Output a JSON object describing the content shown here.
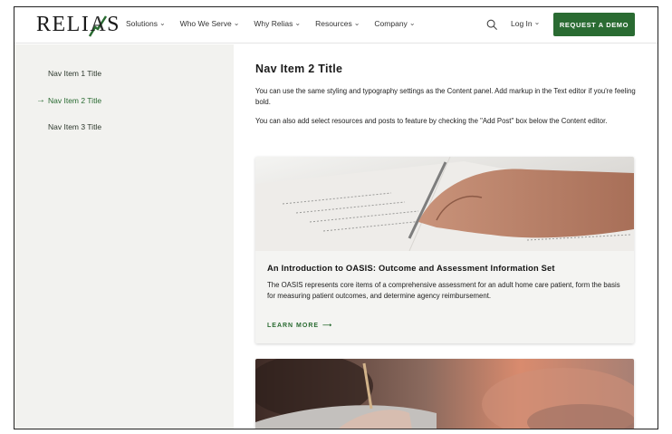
{
  "brand": {
    "logo_text_left": "REL",
    "logo_text_mid": "I",
    "logo_text_a": "A",
    "logo_text_right": "S",
    "accent_color": "#2a6b32"
  },
  "header": {
    "menu": [
      {
        "label": "Solutions"
      },
      {
        "label": "Who We Serve"
      },
      {
        "label": "Why Relias"
      },
      {
        "label": "Resources"
      },
      {
        "label": "Company"
      }
    ],
    "login_label": "Log In",
    "cta_label": "REQUEST A DEMO",
    "icons": {
      "search": "search-icon",
      "chevron": "chevron-down-icon"
    }
  },
  "sidebar": {
    "items": [
      {
        "label": "Nav Item 1 Title",
        "active": false
      },
      {
        "label": "Nav Item 2 Title",
        "active": true
      },
      {
        "label": "Nav Item 3 Title",
        "active": false
      }
    ],
    "active_marker": "→"
  },
  "main": {
    "title": "Nav Item 2 Title",
    "paragraph_1": "You can use the same styling and typography settings as the Content panel. Add markup in the Text editor if you're feeling bold.",
    "paragraph_2": "You can also add select resources and posts to feature by checking the \"Add Post\" box below the Content editor.",
    "cards": [
      {
        "title": "An Introduction to OASIS: Outcome and Assessment Information Set",
        "description": "The OASIS represents core items of a comprehensive assessment for an adult home care patient, form the basis for measuring patient outcomes, and determine agency reimbursement.",
        "cta": "LEARN MORE",
        "cta_arrow": "⟶"
      }
    ]
  }
}
